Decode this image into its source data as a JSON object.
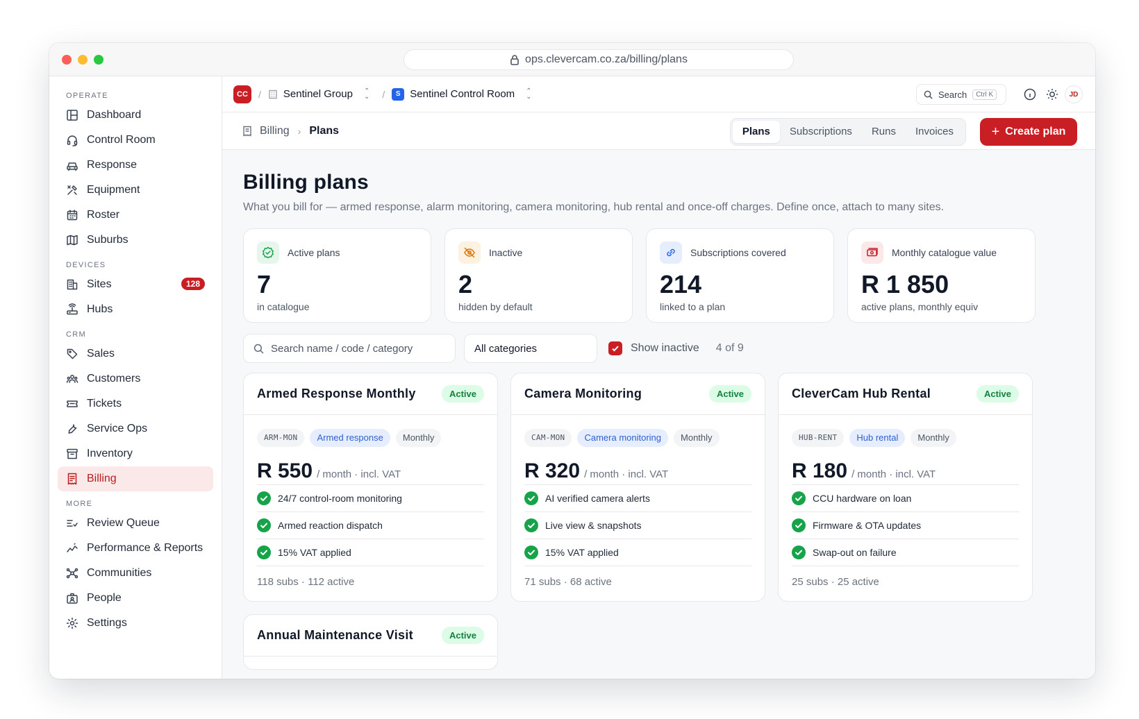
{
  "browser": {
    "url": "ops.clevercam.co.za/billing/plans"
  },
  "sidebar": {
    "sections": [
      {
        "label": "OPERATE",
        "items": [
          {
            "label": "Dashboard",
            "icon": "dashboard-icon"
          },
          {
            "label": "Control Room",
            "icon": "headset-icon"
          },
          {
            "label": "Response",
            "icon": "car-icon"
          },
          {
            "label": "Equipment",
            "icon": "tools-icon"
          },
          {
            "label": "Roster",
            "icon": "calendar-icon"
          },
          {
            "label": "Suburbs",
            "icon": "map-icon"
          }
        ]
      },
      {
        "label": "DEVICES",
        "items": [
          {
            "label": "Sites",
            "icon": "building-icon",
            "badge": "128"
          },
          {
            "label": "Hubs",
            "icon": "router-icon"
          }
        ]
      },
      {
        "label": "CRM",
        "items": [
          {
            "label": "Sales",
            "icon": "tag-icon"
          },
          {
            "label": "Customers",
            "icon": "users-icon"
          },
          {
            "label": "Tickets",
            "icon": "ticket-icon"
          },
          {
            "label": "Service Ops",
            "icon": "wrench-icon"
          },
          {
            "label": "Inventory",
            "icon": "archive-icon"
          },
          {
            "label": "Billing",
            "icon": "receipt-icon",
            "active": true
          }
        ]
      },
      {
        "label": "MORE",
        "items": [
          {
            "label": "Review Queue",
            "icon": "review-icon"
          },
          {
            "label": "Performance & Reports",
            "icon": "chart-icon"
          },
          {
            "label": "Communities",
            "icon": "network-icon"
          },
          {
            "label": "People",
            "icon": "id-badge-icon"
          },
          {
            "label": "Settings",
            "icon": "gear-icon"
          }
        ]
      }
    ]
  },
  "topbar": {
    "org_logo": "CC",
    "separator": "/",
    "group": "Sentinel Group",
    "room_logo": "S",
    "room": "Sentinel Control Room",
    "search_label": "Search",
    "search_kbd": "Ctrl K",
    "avatar": "JD"
  },
  "subbar": {
    "crumb_root": "Billing",
    "crumb_current": "Plans",
    "tabs": [
      "Plans",
      "Subscriptions",
      "Runs",
      "Invoices"
    ],
    "active_tab": "Plans",
    "create_label": "Create plan"
  },
  "page": {
    "title": "Billing plans",
    "description": "What you bill for — armed response, alarm monitoring, camera monitoring, hub rental and once-off charges. Define once, attach to many sites."
  },
  "stats": [
    {
      "label": "Active plans",
      "value": "7",
      "sub": "in catalogue",
      "icon": "badge-check-icon",
      "color": "#16a34a",
      "bg": "#e7f6ec"
    },
    {
      "label": "Inactive",
      "value": "2",
      "sub": "hidden by default",
      "icon": "eye-off-icon",
      "color": "#d97706",
      "bg": "#fdf1e2"
    },
    {
      "label": "Subscriptions covered",
      "value": "214",
      "sub": "linked to a plan",
      "icon": "link-icon",
      "color": "#2563eb",
      "bg": "#e6edfd"
    },
    {
      "label": "Monthly catalogue value",
      "value": "R 1 850",
      "sub": "active plans, monthly equiv",
      "icon": "money-icon",
      "color": "#c81e24",
      "bg": "#fbe9ea"
    }
  ],
  "filters": {
    "search_placeholder": "Search name / code / category",
    "category": "All categories",
    "show_inactive": "Show inactive",
    "count": "4 of 9"
  },
  "plans": [
    {
      "name": "Armed Response Monthly",
      "status": "Active",
      "code": "ARM-MON",
      "category": "Armed response",
      "cycle": "Monthly",
      "price": "R 550",
      "unit": "/ month · incl. VAT",
      "features": [
        "24/7 control-room monitoring",
        "Armed reaction dispatch",
        "15% VAT applied"
      ],
      "subs": "118 subs · 112 active"
    },
    {
      "name": "Camera Monitoring",
      "status": "Active",
      "code": "CAM-MON",
      "category": "Camera monitoring",
      "cycle": "Monthly",
      "price": "R 320",
      "unit": "/ month · incl. VAT",
      "features": [
        "AI verified camera alerts",
        "Live view & snapshots",
        "15% VAT applied"
      ],
      "subs": "71 subs · 68 active"
    },
    {
      "name": "CleverCam Hub Rental",
      "status": "Active",
      "code": "HUB-RENT",
      "category": "Hub rental",
      "cycle": "Monthly",
      "price": "R 180",
      "unit": "/ month · incl. VAT",
      "features": [
        "CCU hardware on loan",
        "Firmware & OTA updates",
        "Swap-out on failure"
      ],
      "subs": "25 subs · 25 active"
    },
    {
      "name": "Annual Maintenance Visit",
      "status": "Active"
    }
  ],
  "colors": {
    "accent": "#c81e24",
    "success": "#16a34a",
    "info": "#2563eb"
  }
}
